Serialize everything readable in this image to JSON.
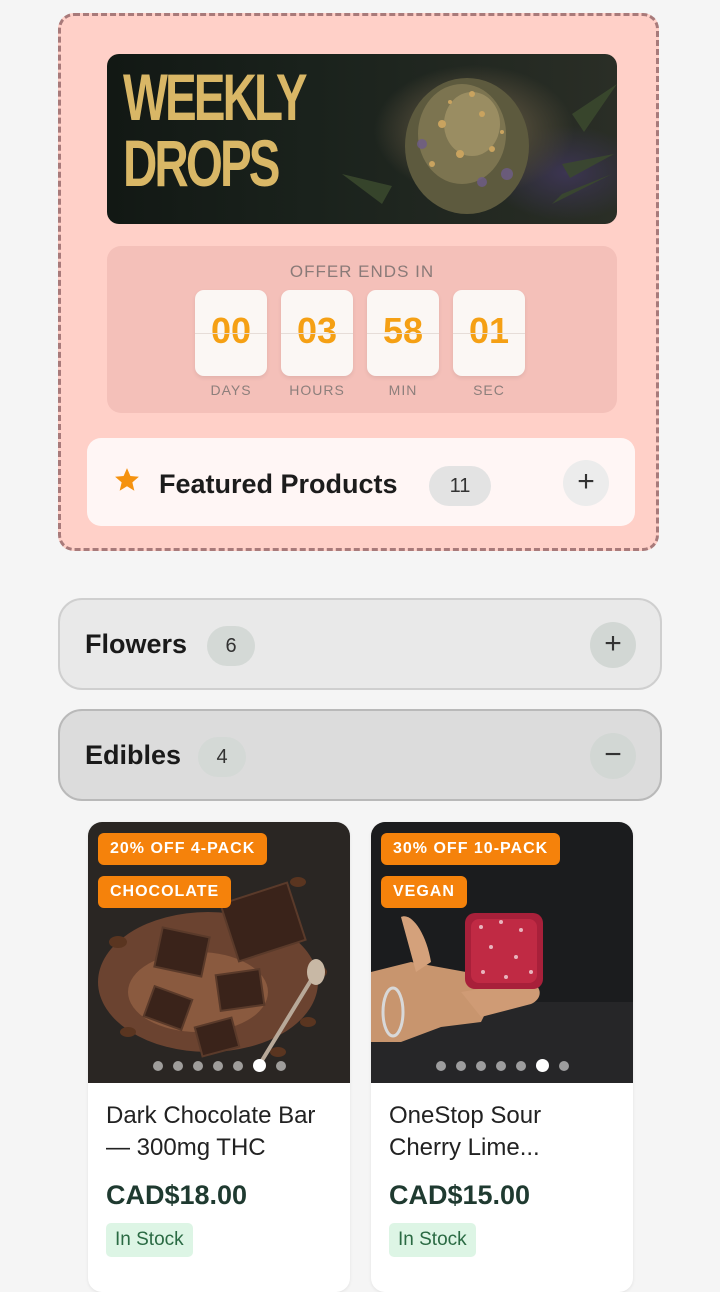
{
  "promo": {
    "banner_title": "WEEKLY\nDROPS",
    "offer_label": "OFFER ENDS IN",
    "countdown": [
      {
        "value": "00",
        "unit": "DAYS"
      },
      {
        "value": "03",
        "unit": "HOURS"
      },
      {
        "value": "58",
        "unit": "MIN"
      },
      {
        "value": "01",
        "unit": "SEC"
      }
    ],
    "featured": {
      "icon": "star-icon",
      "title": "Featured Products",
      "count": "11",
      "toggle": "+"
    }
  },
  "categories": [
    {
      "title": "Flowers",
      "count": "6",
      "toggle": "+"
    },
    {
      "title": "Edibles",
      "count": "4",
      "toggle": "−"
    }
  ],
  "products": [
    {
      "badges": [
        "20% OFF 4-PACK",
        "CHOCOLATE"
      ],
      "name": "Dark Chocolate Bar — 300mg THC",
      "price": "CAD$18.00",
      "stock": "In Stock",
      "image_dots": 7,
      "active_dot": 6
    },
    {
      "badges": [
        "30% OFF 10-PACK",
        "VEGAN"
      ],
      "name": "OneStop Sour Cherry Lime...",
      "price": "CAD$15.00",
      "stock": "In Stock",
      "image_dots": 7,
      "active_dot": 6
    }
  ],
  "colors": {
    "accent": "#f5820b",
    "countdown_digit": "#f5a014",
    "promo_bg": "#ffd0c8",
    "price": "#1f3a30"
  }
}
